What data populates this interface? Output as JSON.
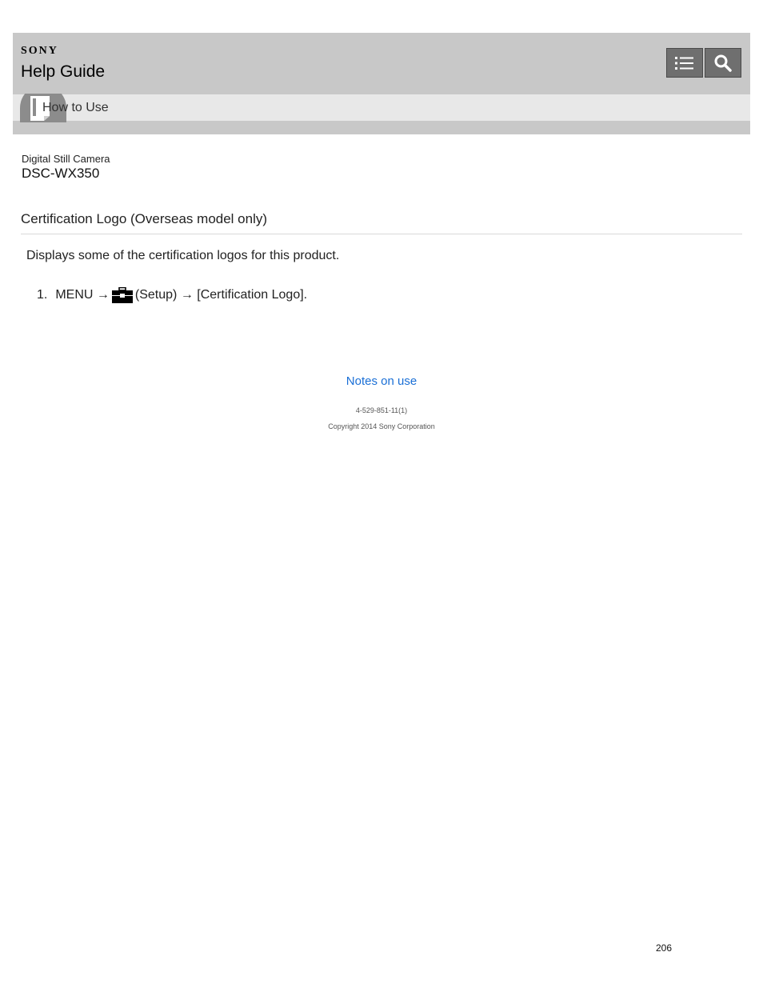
{
  "header": {
    "brand": "SONY",
    "title": "Help Guide",
    "toc_button": "list-icon",
    "search_button": "search-icon"
  },
  "subbar": {
    "label": "How to Use",
    "icon": "book-icon"
  },
  "product": {
    "category": "Digital Still Camera",
    "model": "DSC-WX350"
  },
  "topic": {
    "title": "Certification Logo (Overseas model only)",
    "description": "Displays some of the certification logos for this product.",
    "steps": [
      {
        "number": "1.",
        "part1": "MENU →",
        "icon": "toolbox-icon",
        "part2": "(Setup) → [Certification Logo]."
      }
    ]
  },
  "footer": {
    "link": "Notes on use",
    "code": "4-529-851-11(1)",
    "copyright": "Copyright 2014 Sony Corporation",
    "page_number": "206"
  },
  "colors": {
    "header_bg": "#c8c8c8",
    "subbar_bg": "#e8e8e8",
    "button_bg": "#6f6f6f",
    "link": "#1a6fd6"
  }
}
